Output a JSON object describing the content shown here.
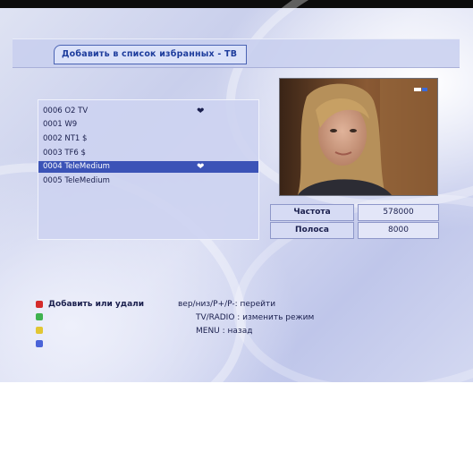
{
  "title": "Добавить в список избранных - TB",
  "channels": [
    {
      "label": "0006 O2 TV",
      "fav": true
    },
    {
      "label": "0001 W9",
      "fav": false
    },
    {
      "label": "0002 NT1 $",
      "fav": false
    },
    {
      "label": "0003 TF6 $",
      "fav": false
    },
    {
      "label": "0004 TeleMedium",
      "fav": true,
      "selected": true
    },
    {
      "label": "0005 TeleMedium",
      "fav": false
    }
  ],
  "info": {
    "freq_label": "Частота",
    "freq_value": "578000",
    "band_label": "Полоса",
    "band_value": "8000"
  },
  "help": {
    "red_text": "Добавить или удали",
    "nav_text": "вер/низ/P+/P-: перейти",
    "mode_text": "TV/RADIO : изменить режим",
    "menu_text": "MENU : назад"
  },
  "colors": {
    "selected_row": "#3b53b7",
    "red_key": "#d42b2b",
    "green_key": "#3fb24f",
    "yellow_key": "#e1c633",
    "blue_key": "#4a63d8"
  },
  "icons": {
    "favorite": "heart-icon"
  }
}
